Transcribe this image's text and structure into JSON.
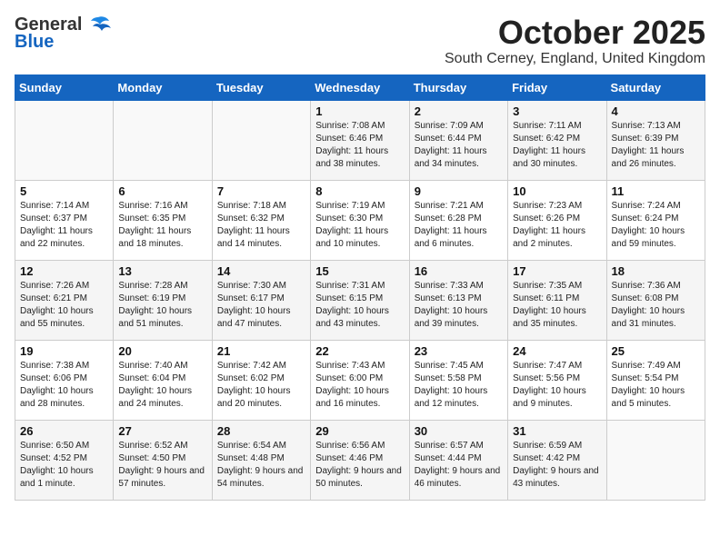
{
  "header": {
    "logo_general": "General",
    "logo_blue": "Blue",
    "month_title": "October 2025",
    "subtitle": "South Cerney, England, United Kingdom"
  },
  "days_of_week": [
    "Sunday",
    "Monday",
    "Tuesday",
    "Wednesday",
    "Thursday",
    "Friday",
    "Saturday"
  ],
  "weeks": [
    [
      {
        "day": "",
        "sunrise": "",
        "sunset": "",
        "daylight": "",
        "empty": true
      },
      {
        "day": "",
        "sunrise": "",
        "sunset": "",
        "daylight": "",
        "empty": true
      },
      {
        "day": "",
        "sunrise": "",
        "sunset": "",
        "daylight": "",
        "empty": true
      },
      {
        "day": "1",
        "sunrise": "Sunrise: 7:08 AM",
        "sunset": "Sunset: 6:46 PM",
        "daylight": "Daylight: 11 hours and 38 minutes."
      },
      {
        "day": "2",
        "sunrise": "Sunrise: 7:09 AM",
        "sunset": "Sunset: 6:44 PM",
        "daylight": "Daylight: 11 hours and 34 minutes."
      },
      {
        "day": "3",
        "sunrise": "Sunrise: 7:11 AM",
        "sunset": "Sunset: 6:42 PM",
        "daylight": "Daylight: 11 hours and 30 minutes."
      },
      {
        "day": "4",
        "sunrise": "Sunrise: 7:13 AM",
        "sunset": "Sunset: 6:39 PM",
        "daylight": "Daylight: 11 hours and 26 minutes."
      }
    ],
    [
      {
        "day": "5",
        "sunrise": "Sunrise: 7:14 AM",
        "sunset": "Sunset: 6:37 PM",
        "daylight": "Daylight: 11 hours and 22 minutes."
      },
      {
        "day": "6",
        "sunrise": "Sunrise: 7:16 AM",
        "sunset": "Sunset: 6:35 PM",
        "daylight": "Daylight: 11 hours and 18 minutes."
      },
      {
        "day": "7",
        "sunrise": "Sunrise: 7:18 AM",
        "sunset": "Sunset: 6:32 PM",
        "daylight": "Daylight: 11 hours and 14 minutes."
      },
      {
        "day": "8",
        "sunrise": "Sunrise: 7:19 AM",
        "sunset": "Sunset: 6:30 PM",
        "daylight": "Daylight: 11 hours and 10 minutes."
      },
      {
        "day": "9",
        "sunrise": "Sunrise: 7:21 AM",
        "sunset": "Sunset: 6:28 PM",
        "daylight": "Daylight: 11 hours and 6 minutes."
      },
      {
        "day": "10",
        "sunrise": "Sunrise: 7:23 AM",
        "sunset": "Sunset: 6:26 PM",
        "daylight": "Daylight: 11 hours and 2 minutes."
      },
      {
        "day": "11",
        "sunrise": "Sunrise: 7:24 AM",
        "sunset": "Sunset: 6:24 PM",
        "daylight": "Daylight: 10 hours and 59 minutes."
      }
    ],
    [
      {
        "day": "12",
        "sunrise": "Sunrise: 7:26 AM",
        "sunset": "Sunset: 6:21 PM",
        "daylight": "Daylight: 10 hours and 55 minutes."
      },
      {
        "day": "13",
        "sunrise": "Sunrise: 7:28 AM",
        "sunset": "Sunset: 6:19 PM",
        "daylight": "Daylight: 10 hours and 51 minutes."
      },
      {
        "day": "14",
        "sunrise": "Sunrise: 7:30 AM",
        "sunset": "Sunset: 6:17 PM",
        "daylight": "Daylight: 10 hours and 47 minutes."
      },
      {
        "day": "15",
        "sunrise": "Sunrise: 7:31 AM",
        "sunset": "Sunset: 6:15 PM",
        "daylight": "Daylight: 10 hours and 43 minutes."
      },
      {
        "day": "16",
        "sunrise": "Sunrise: 7:33 AM",
        "sunset": "Sunset: 6:13 PM",
        "daylight": "Daylight: 10 hours and 39 minutes."
      },
      {
        "day": "17",
        "sunrise": "Sunrise: 7:35 AM",
        "sunset": "Sunset: 6:11 PM",
        "daylight": "Daylight: 10 hours and 35 minutes."
      },
      {
        "day": "18",
        "sunrise": "Sunrise: 7:36 AM",
        "sunset": "Sunset: 6:08 PM",
        "daylight": "Daylight: 10 hours and 31 minutes."
      }
    ],
    [
      {
        "day": "19",
        "sunrise": "Sunrise: 7:38 AM",
        "sunset": "Sunset: 6:06 PM",
        "daylight": "Daylight: 10 hours and 28 minutes."
      },
      {
        "day": "20",
        "sunrise": "Sunrise: 7:40 AM",
        "sunset": "Sunset: 6:04 PM",
        "daylight": "Daylight: 10 hours and 24 minutes."
      },
      {
        "day": "21",
        "sunrise": "Sunrise: 7:42 AM",
        "sunset": "Sunset: 6:02 PM",
        "daylight": "Daylight: 10 hours and 20 minutes."
      },
      {
        "day": "22",
        "sunrise": "Sunrise: 7:43 AM",
        "sunset": "Sunset: 6:00 PM",
        "daylight": "Daylight: 10 hours and 16 minutes."
      },
      {
        "day": "23",
        "sunrise": "Sunrise: 7:45 AM",
        "sunset": "Sunset: 5:58 PM",
        "daylight": "Daylight: 10 hours and 12 minutes."
      },
      {
        "day": "24",
        "sunrise": "Sunrise: 7:47 AM",
        "sunset": "Sunset: 5:56 PM",
        "daylight": "Daylight: 10 hours and 9 minutes."
      },
      {
        "day": "25",
        "sunrise": "Sunrise: 7:49 AM",
        "sunset": "Sunset: 5:54 PM",
        "daylight": "Daylight: 10 hours and 5 minutes."
      }
    ],
    [
      {
        "day": "26",
        "sunrise": "Sunrise: 6:50 AM",
        "sunset": "Sunset: 4:52 PM",
        "daylight": "Daylight: 10 hours and 1 minute."
      },
      {
        "day": "27",
        "sunrise": "Sunrise: 6:52 AM",
        "sunset": "Sunset: 4:50 PM",
        "daylight": "Daylight: 9 hours and 57 minutes."
      },
      {
        "day": "28",
        "sunrise": "Sunrise: 6:54 AM",
        "sunset": "Sunset: 4:48 PM",
        "daylight": "Daylight: 9 hours and 54 minutes."
      },
      {
        "day": "29",
        "sunrise": "Sunrise: 6:56 AM",
        "sunset": "Sunset: 4:46 PM",
        "daylight": "Daylight: 9 hours and 50 minutes."
      },
      {
        "day": "30",
        "sunrise": "Sunrise: 6:57 AM",
        "sunset": "Sunset: 4:44 PM",
        "daylight": "Daylight: 9 hours and 46 minutes."
      },
      {
        "day": "31",
        "sunrise": "Sunrise: 6:59 AM",
        "sunset": "Sunset: 4:42 PM",
        "daylight": "Daylight: 9 hours and 43 minutes."
      },
      {
        "day": "",
        "sunrise": "",
        "sunset": "",
        "daylight": "",
        "empty": true
      }
    ]
  ]
}
